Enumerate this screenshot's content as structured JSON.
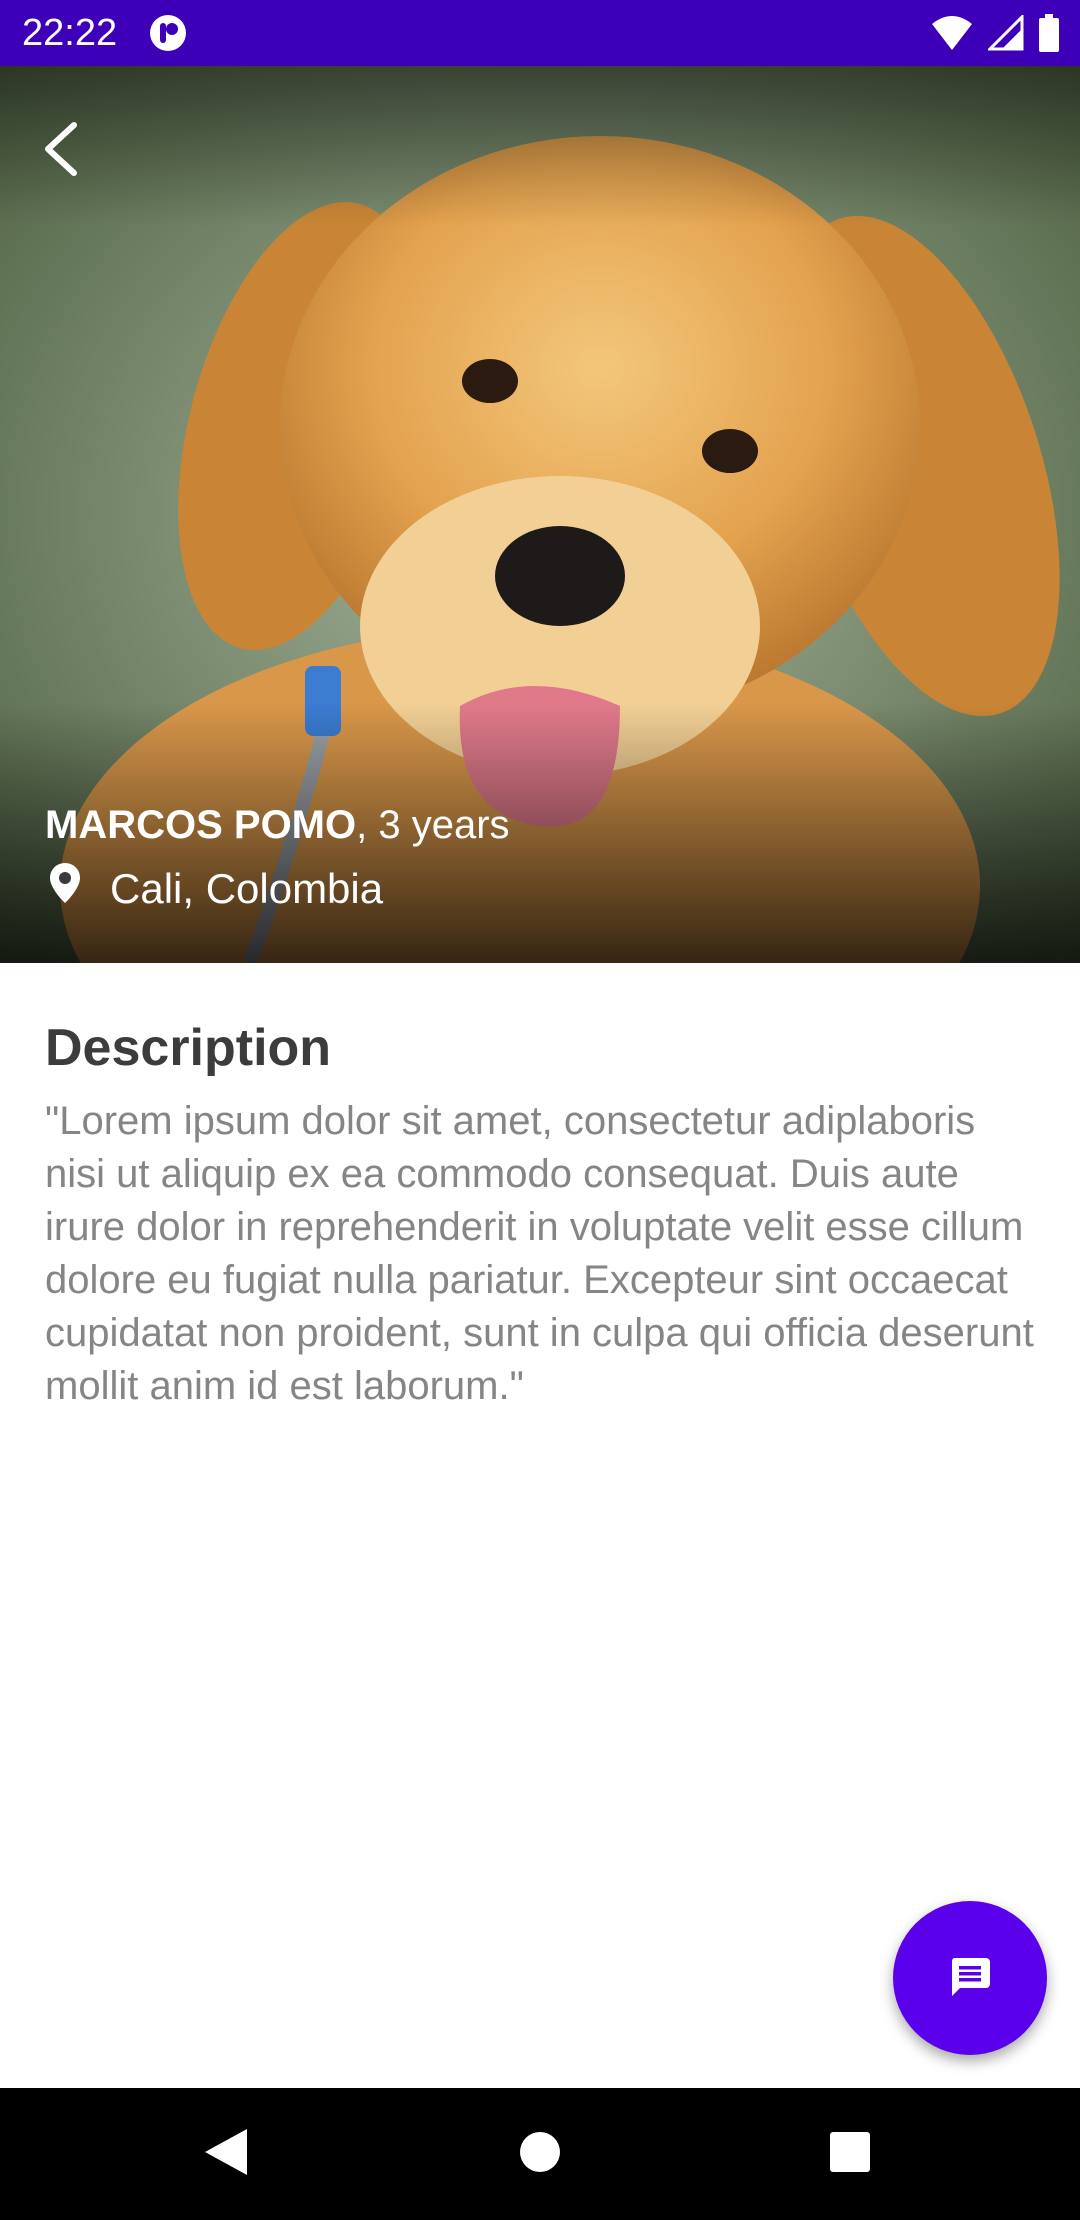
{
  "status_bar": {
    "time": "22:22",
    "icons": [
      "app-notification-icon",
      "wifi-icon",
      "cell-signal-icon",
      "battery-icon"
    ]
  },
  "hero": {
    "name": "MARCOS POMO",
    "age": ", 3 years",
    "location": "Cali, Colombia"
  },
  "description": {
    "heading": "Description",
    "text": "\"Lorem ipsum dolor sit amet, consectetur adiplaboris nisi ut aliquip ex ea commodo consequat. Duis aute irure dolor in reprehenderit in voluptate velit esse cillum dolore eu fugiat nulla pariatur. Excepteur sint occaecat cupidatat non proident, sunt in culpa qui officia deserunt mollit anim id est laborum.\""
  },
  "fab": {
    "icon": "message-icon",
    "color": "#5b00ea"
  },
  "colors": {
    "status_bar": "#3d00b8",
    "heading": "#3c3c3c",
    "body_text": "#858585"
  },
  "nav_bar": {
    "buttons": [
      "back-triangle-icon",
      "home-circle-icon",
      "recents-square-icon"
    ]
  }
}
